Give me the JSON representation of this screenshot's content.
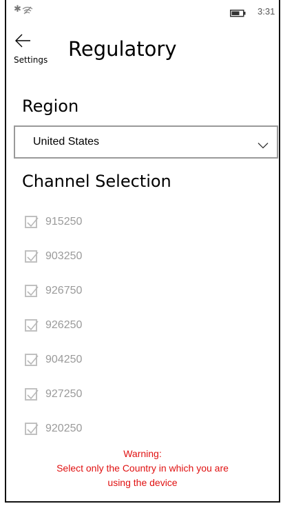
{
  "status_bar": {
    "time": "3:31",
    "bluetooth_icon": "bluetooth-icon",
    "wifi_icon": "wifi-off-icon",
    "battery_icon": "battery-icon"
  },
  "header": {
    "back_label": "Settings",
    "back_icon": "back-arrow-icon",
    "title": "Regulatory"
  },
  "region": {
    "heading": "Region",
    "selected": "United States",
    "dropdown_icon": "chevron-down-icon"
  },
  "channels": {
    "heading": "Channel Selection",
    "items": [
      {
        "label": "915250",
        "checked": true,
        "enabled": false
      },
      {
        "label": "903250",
        "checked": true,
        "enabled": false
      },
      {
        "label": "926750",
        "checked": true,
        "enabled": false
      },
      {
        "label": "926250",
        "checked": true,
        "enabled": false
      },
      {
        "label": "904250",
        "checked": true,
        "enabled": false
      },
      {
        "label": "927250",
        "checked": true,
        "enabled": false
      },
      {
        "label": "920250",
        "checked": true,
        "enabled": false
      }
    ]
  },
  "warning": {
    "line1": "Warning:",
    "line2": "Select only the Country in which you are",
    "line3": "using the device"
  },
  "colors": {
    "warning": "#e01010",
    "disabled_text": "#9a9a9a",
    "border": "#999999"
  }
}
